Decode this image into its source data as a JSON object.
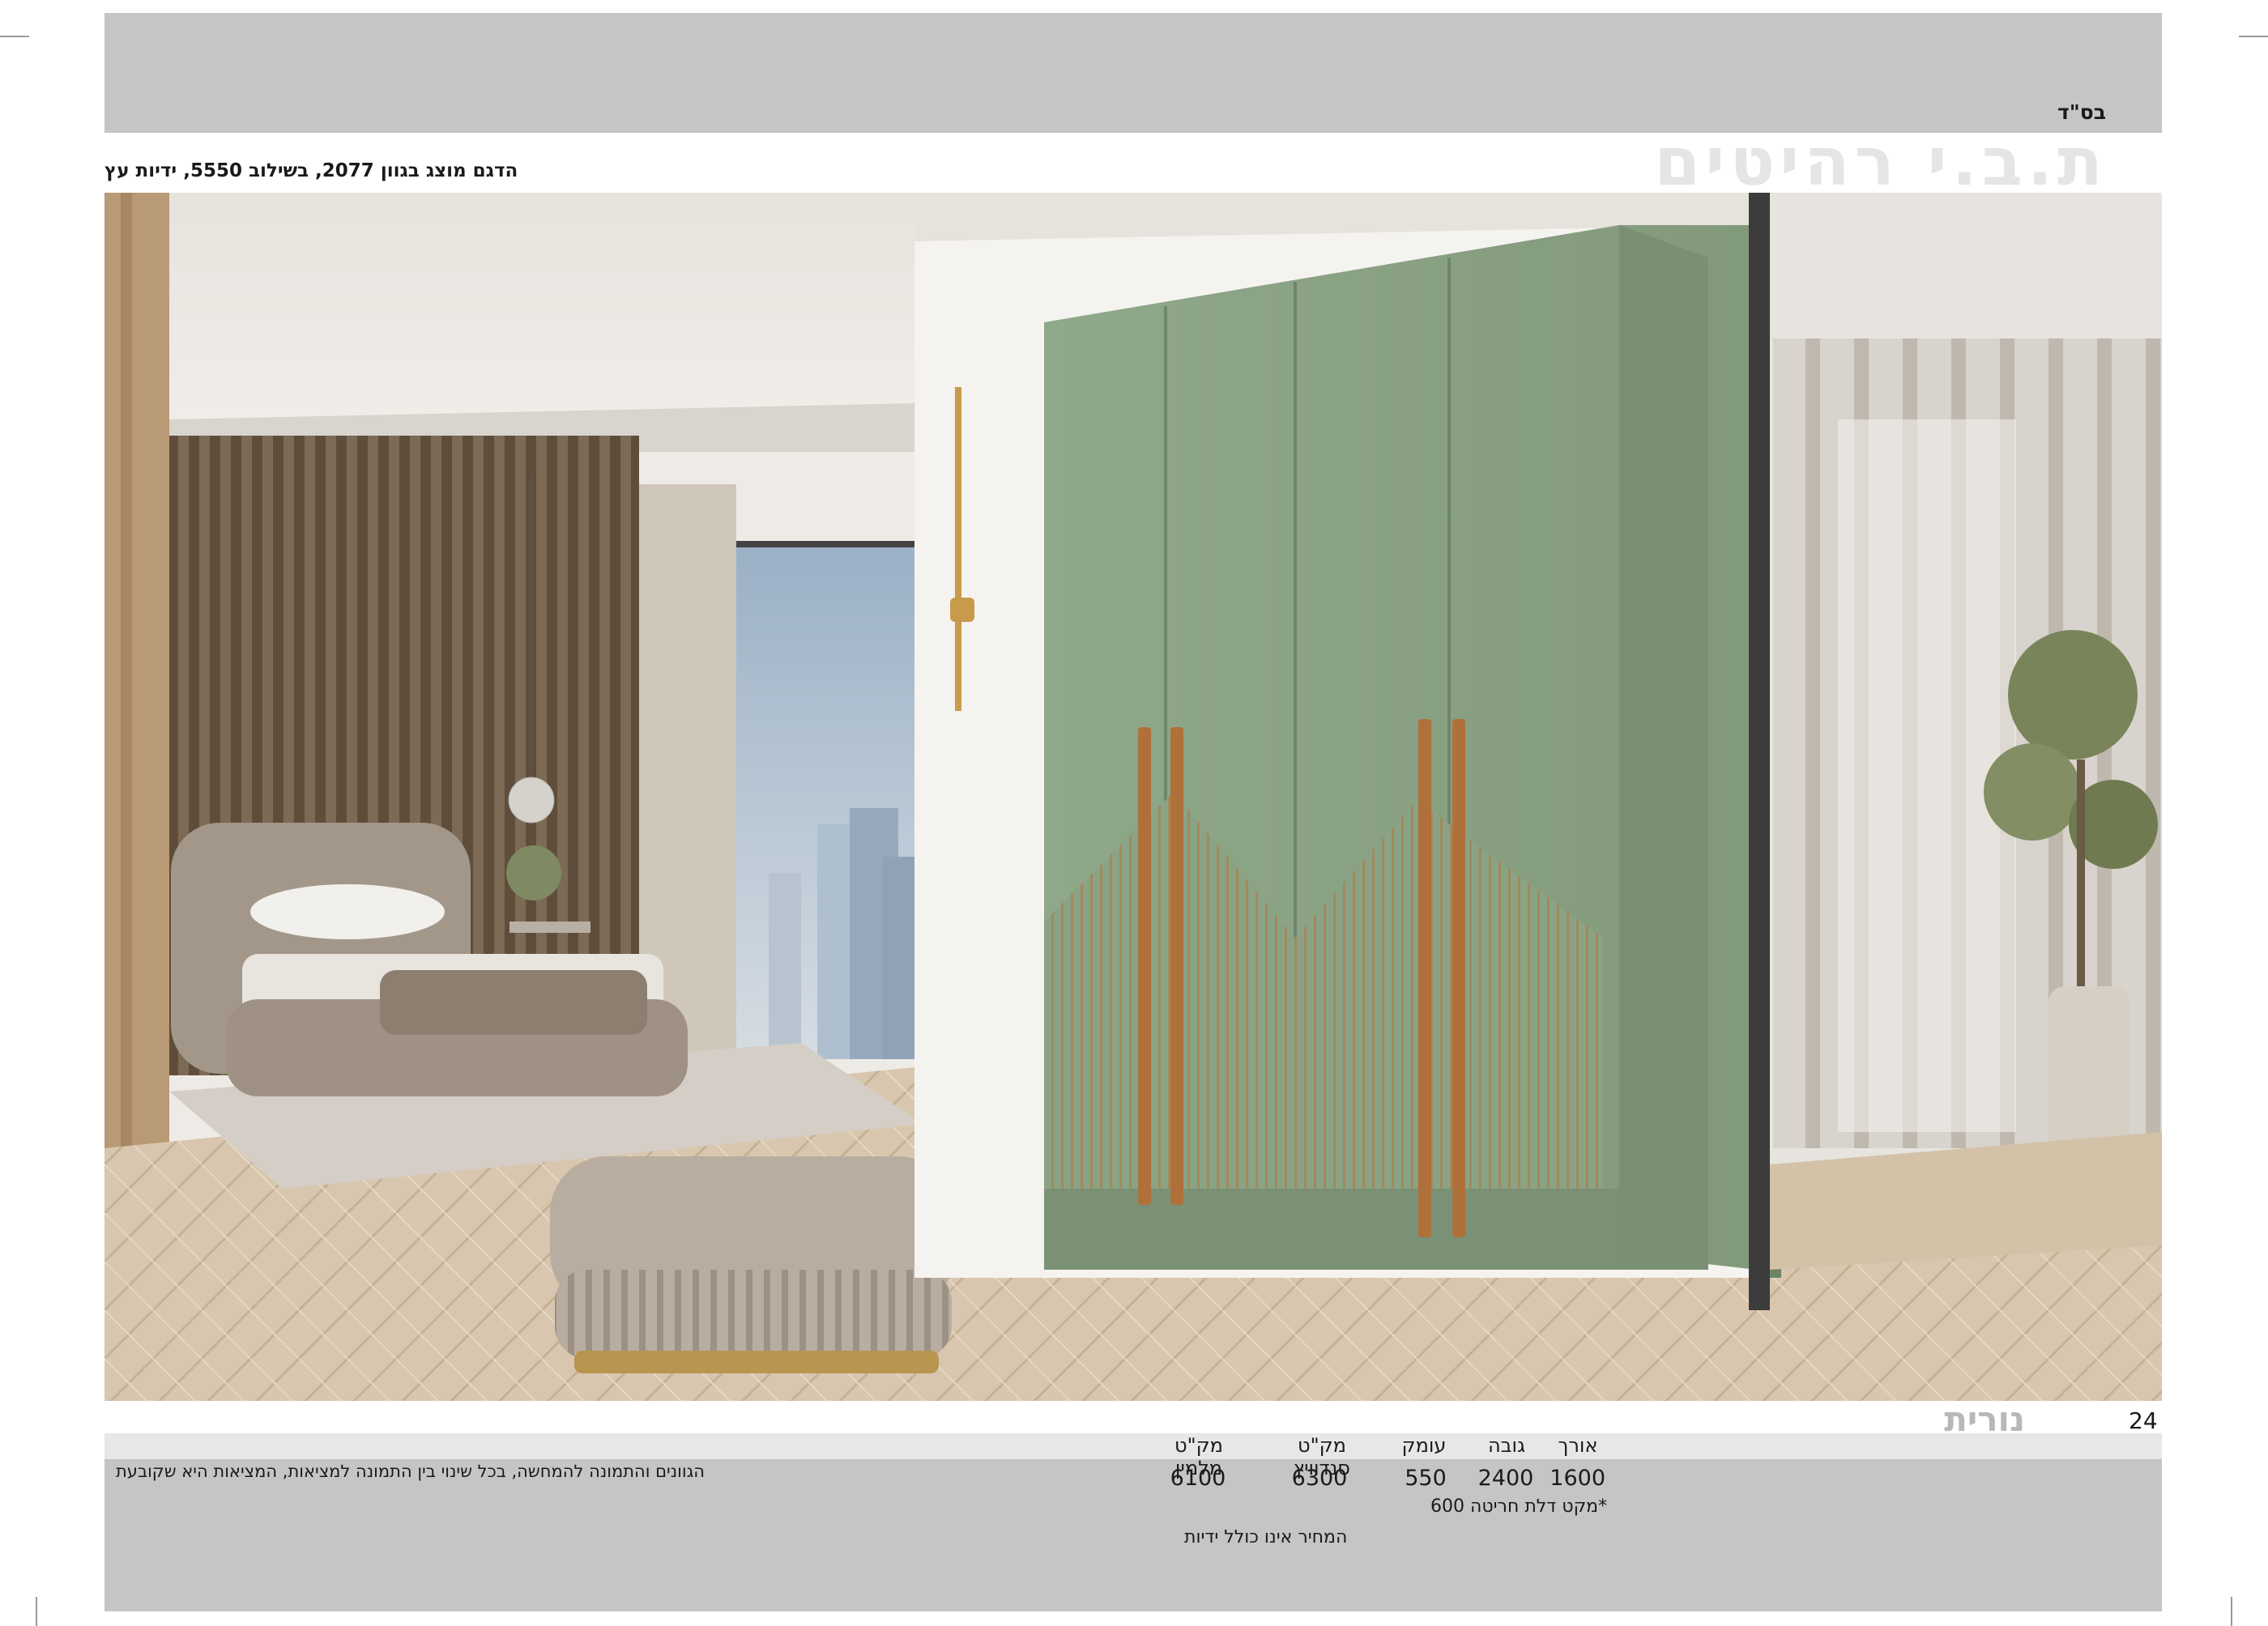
{
  "header": {
    "besd": "בס\"ד",
    "brand": "ת.ב.י רהיטים",
    "caption": "הדגם מוצג בגוון 2077, בשילוב 5550, ידיות עץ"
  },
  "photo": {
    "alt": "חדר שינה עם ארון ירוק בעל ארבע דלתות, ידיות עץ, מיטה מרופדת ופוף"
  },
  "product": {
    "model_name": "נורית",
    "page_number": "24"
  },
  "specs": {
    "headers": {
      "length": "אורך",
      "height": "גובה",
      "depth": "עומק",
      "sandwich_sku": "מק\"ט סנדוויץ",
      "melamine_sku": "מק\"ט מלמין"
    },
    "values": {
      "length": "1600",
      "height": "2400",
      "depth": "550",
      "sandwich_sku": "6300",
      "melamine_sku": "6100"
    },
    "notes": {
      "groove_door": "*מקט דלת חריטה 600",
      "price_note": "המחיר אינו כולל ידיות"
    }
  },
  "footer": {
    "disclaimer": "הגוונים והתמונה להמחשה, בכל שינוי בין התמונה למציאות, המציאות היא שקובעת"
  },
  "colors": {
    "band_gray": "#c5c5c5",
    "wardrobe_green": "#8aa384",
    "wood_handle": "#b0703a"
  }
}
